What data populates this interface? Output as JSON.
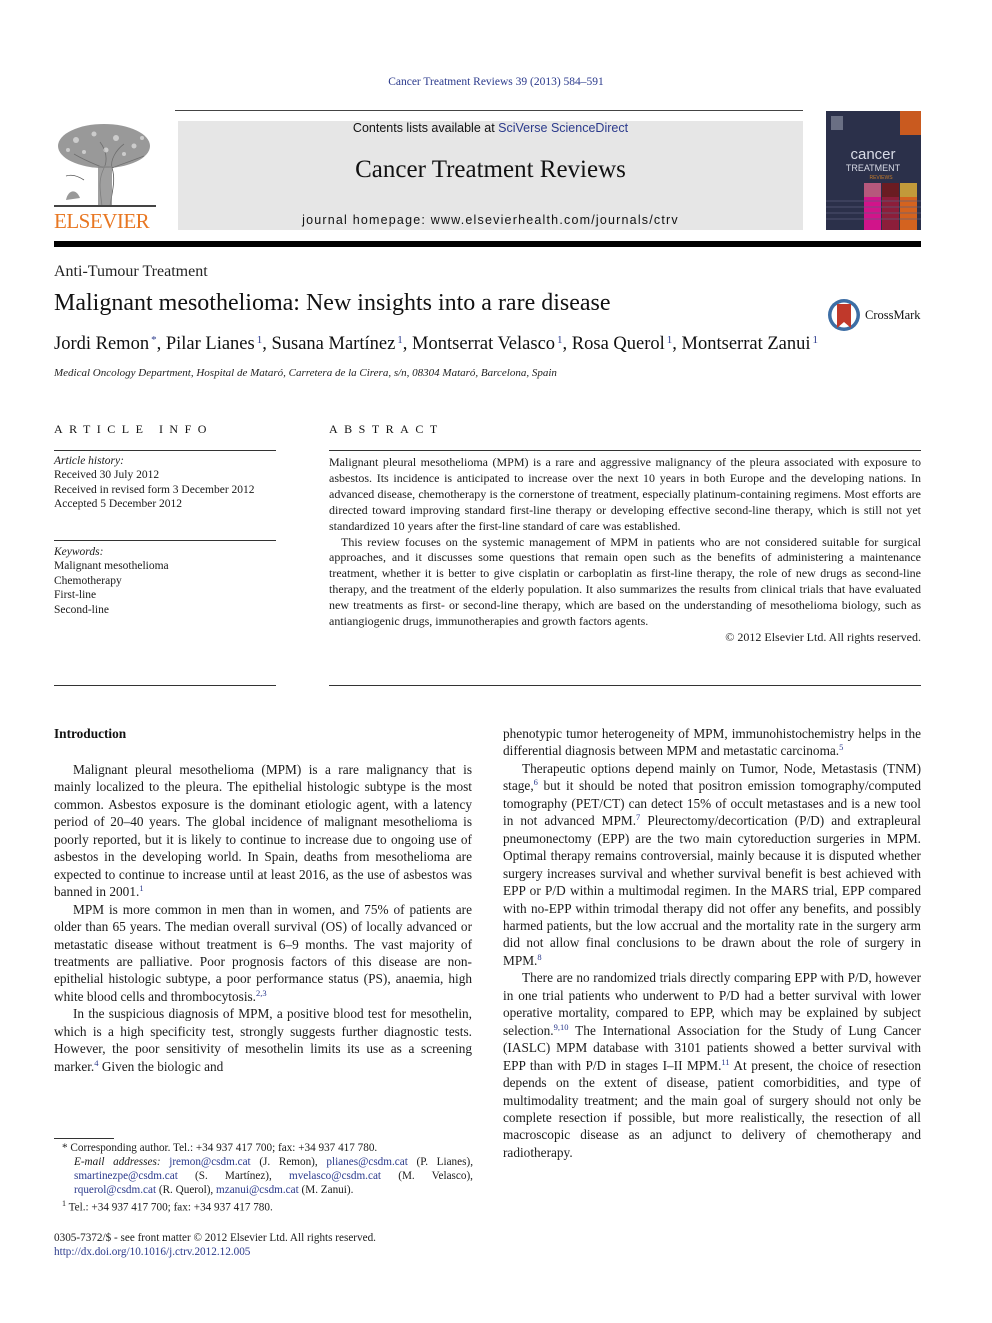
{
  "citation": "Cancer Treatment Reviews 39 (2013) 584–591",
  "header": {
    "contents_prefix": "Contents lists available at ",
    "contents_link": "SciVerse ScienceDirect",
    "journal_title": "Cancer Treatment Reviews",
    "homepage": "journal homepage: www.elsevierhealth.com/journals/ctrv",
    "publisher_logo_text": "ELSEVIER",
    "cover": {
      "line1": "cancer",
      "line2": "TREATMENT",
      "line3": "REVIEWS"
    },
    "colors": {
      "publisher_orange": "#e87722",
      "link_blue": "#2b3a8c",
      "banner_gray": "#e6e6e6"
    }
  },
  "article": {
    "section": "Anti-Tumour Treatment",
    "title": "Malignant mesothelioma: New insights into a rare disease",
    "crossmark_label": "CrossMark",
    "authors": [
      {
        "name": "Jordi Remon",
        "mark": "*"
      },
      {
        "name": "Pilar Lianes",
        "mark": "1"
      },
      {
        "name": "Susana Martínez",
        "mark": "1"
      },
      {
        "name": "Montserrat Velasco",
        "mark": "1"
      },
      {
        "name": "Rosa Querol",
        "mark": "1"
      },
      {
        "name": "Montserrat Zanui",
        "mark": "1"
      }
    ],
    "affiliation": "Medical Oncology Department, Hospital de Mataró, Carretera de la Cirera, s/n, 08304 Mataró, Barcelona, Spain"
  },
  "article_info": {
    "heading": "ARTICLE INFO",
    "history_label": "Article history:",
    "history": [
      "Received 30 July 2012",
      "Received in revised form 3 December 2012",
      "Accepted 5 December 2012"
    ],
    "keywords_label": "Keywords:",
    "keywords": [
      "Malignant mesothelioma",
      "Chemotherapy",
      "First-line",
      "Second-line"
    ]
  },
  "abstract": {
    "heading": "ABSTRACT",
    "paragraphs": [
      "Malignant pleural mesothelioma (MPM) is a rare and aggressive malignancy of the pleura associated with exposure to asbestos. Its incidence is anticipated to increase over the next 10 years in both Europe and the developing nations. In advanced disease, chemotherapy is the cornerstone of treatment, especially platinum-containing regimens. Most efforts are directed toward improving standard first-line therapy or developing effective second-line therapy, which is still not yet standardized 10 years after the first-line standard of care was established.",
      "This review focuses on the systemic management of MPM in patients who are not considered suitable for surgical approaches, and it discusses some questions that remain open such as the benefits of administering a maintenance treatment, whether it is better to give cisplatin or carboplatin as first-line therapy, the role of new drugs as second-line therapy, and the treatment of the elderly population. It also summarizes the results from clinical trials that have evaluated new treatments as first- or second-line therapy, which are based on the understanding of mesothelioma biology, such as antiangiogenic drugs, immunotherapies and growth factors agents."
    ],
    "copyright": "© 2012 Elsevier Ltd. All rights reserved."
  },
  "body": {
    "intro_heading": "Introduction",
    "left": [
      {
        "text": "Malignant pleural mesothelioma (MPM) is a rare malignancy that is mainly localized to the pleura. The epithelial histologic subtype is the most common. Asbestos exposure is the dominant etiologic agent, with a latency period of 20–40 years. The global incidence of malignant mesothelioma is poorly reported, but it is likely to continue to increase due to ongoing use of asbestos in the developing world. In Spain, deaths from mesothelioma are expected to continue to increase until at least 2016, as the use of asbestos was banned in 2001.",
        "ref": "1",
        "tail": ""
      },
      {
        "text": "MPM is more common in men than in women, and 75% of patients are older than 65 years. The median overall survival (OS) of locally advanced or metastatic disease without treatment is 6–9 months. The vast majority of treatments are palliative. Poor prognosis factors of this disease are non-epithelial histologic subtype, a poor performance status (PS), anaemia, high white blood cells and thrombocytosis.",
        "ref": "2,3",
        "tail": ""
      },
      {
        "text": "In the suspicious diagnosis of MPM, a positive blood test for mesothelin, which is a high specificity test, strongly suggests further diagnostic tests. However, the poor sensitivity of mesothelin limits its use as a screening marker.",
        "ref": "4",
        "tail": " Given the biologic and"
      }
    ],
    "right": [
      {
        "text": "phenotypic tumor heterogeneity of MPM, immunohistochemistry helps in the differential diagnosis between MPM and metastatic carcinoma.",
        "ref": "5",
        "continued": true
      },
      {
        "segments": [
          {
            "t": "Therapeutic options depend mainly on Tumor, Node, Metastasis (TNM) stage,",
            "r": "6"
          },
          {
            "t": " but it should be noted that positron emission tomography/computed tomography (PET/CT) can detect 15% of occult metastases and is a new tool in not advanced MPM.",
            "r": "7"
          },
          {
            "t": " Pleurectomy/decortication (P/D) and extrapleural pneumonectomy (EPP) are the two main cytoreduction surgeries in MPM. Optimal therapy remains controversial, mainly because it is disputed whether surgery increases survival and whether survival benefit is best achieved with EPP or P/D within a multimodal regimen. In the MARS trial, EPP compared with no-EPP within trimodal therapy did not offer any benefits, and possibly harmed patients, but the low accrual and the mortality rate in the surgery arm did not allow final conclusions to be drawn about the role of surgery in MPM.",
            "r": "8"
          }
        ]
      },
      {
        "segments": [
          {
            "t": "There are no randomized trials directly comparing EPP with P/D, however in one trial patients who underwent to P/D had a better survival with lower operative mortality, compared to EPP, which may be explained by subject selection.",
            "r": "9,10"
          },
          {
            "t": " The International Association for the Study of Lung Cancer (IASLC) MPM database with 3101 patients showed a better survival with EPP than with P/D in stages I–II MPM.",
            "r": "11"
          },
          {
            "t": " At present, the choice of resection depends on the extent of disease, patient comorbidities, and type of multimodality treatment; and the main goal of surgery should not only be complete resection if possible, but more realistically, the resection of all macroscopic disease as an adjunct to delivery of chemotherapy and radiotherapy.",
            "r": ""
          }
        ]
      }
    ]
  },
  "footnotes": {
    "corresponding": "Corresponding author. Tel.: +34 937 417 700; fax: +34 937 417 780.",
    "corresponding_mark": "*",
    "email_label": "E-mail addresses:",
    "emails": [
      {
        "email": "jremon@csdm.cat",
        "who": "(J. Remon)"
      },
      {
        "email": "plianes@csdm.cat",
        "who": "(P. Lianes)"
      },
      {
        "email": "smartinezpe@csdm.cat",
        "who": "(S. Martínez)"
      },
      {
        "email": "mvelasco@csdm.cat",
        "who": "(M. Velasco)"
      },
      {
        "email": "rquerol@csdm.cat",
        "who": "(R. Querol)"
      },
      {
        "email": "mzanui@csdm.cat",
        "who": "(M. Zanui)."
      }
    ],
    "note1_mark": "1",
    "note1": "Tel.: +34 937 417 700; fax: +34 937 417 780.",
    "front_matter": "0305-7372/$ - see front matter © 2012 Elsevier Ltd. All rights reserved.",
    "doi": "http://dx.doi.org/10.1016/j.ctrv.2012.12.005"
  }
}
